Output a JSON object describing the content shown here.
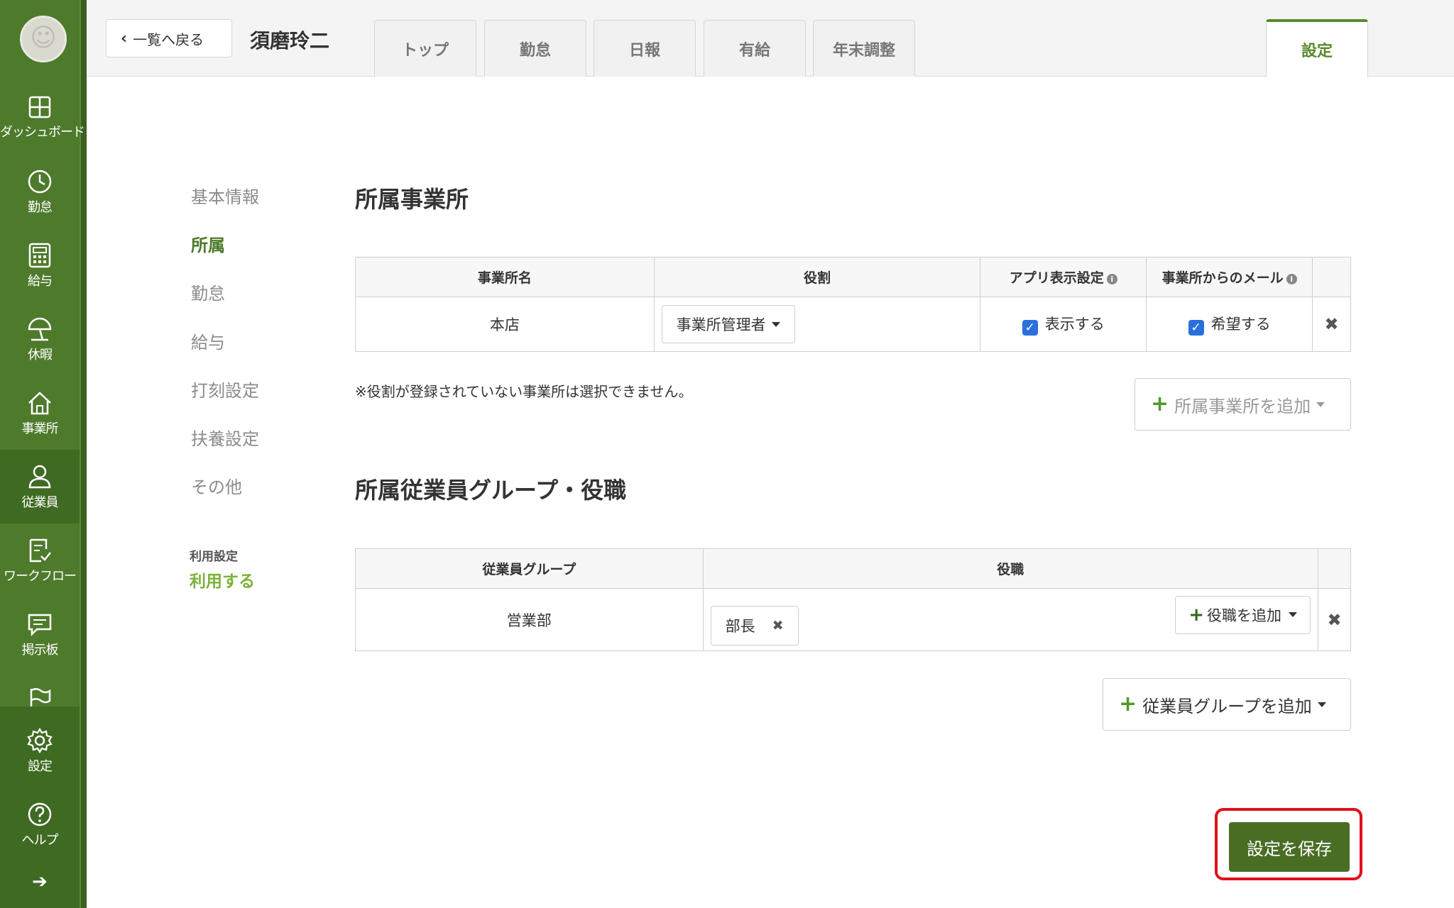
{
  "sidebar": {
    "items": [
      {
        "label": "ダッシュボード",
        "icon": "dashboard-icon"
      },
      {
        "label": "勤怠",
        "icon": "clock-icon"
      },
      {
        "label": "給与",
        "icon": "calculator-icon"
      },
      {
        "label": "休暇",
        "icon": "umbrella-icon"
      },
      {
        "label": "事業所",
        "icon": "home-icon"
      },
      {
        "label": "従業員",
        "icon": "person-icon"
      },
      {
        "label": "ワークフロー",
        "icon": "checklist-icon"
      },
      {
        "label": "掲示板",
        "icon": "message-icon"
      },
      {
        "label": "",
        "icon": "flag-icon"
      },
      {
        "label": "設定",
        "icon": "gear-icon"
      },
      {
        "label": "ヘルプ",
        "icon": "help-icon"
      }
    ],
    "active": "従業員",
    "expand_icon": "arrow-right-icon"
  },
  "header": {
    "back_label": "一覧へ戻る",
    "employee_name": "須磨玲二",
    "tabs": [
      "トップ",
      "勤怠",
      "日報",
      "有給",
      "年末調整"
    ],
    "active_tab": "設定"
  },
  "subnav": {
    "items": [
      "基本情報",
      "所属",
      "勤怠",
      "給与",
      "打刻設定",
      "扶養設定",
      "その他"
    ],
    "active": "所属",
    "usage_label": "利用設定",
    "usage_value": "利用する"
  },
  "office_section": {
    "title": "所属事業所",
    "columns": [
      "事業所名",
      "役割",
      "アプリ表示設定",
      "事業所からのメール"
    ],
    "rows": [
      {
        "name": "本店",
        "role": "事業所管理者",
        "app_display": "表示する",
        "app_display_checked": true,
        "email": "希望する",
        "email_checked": true
      }
    ],
    "note": "※役割が登録されていない事業所は選択できません。",
    "add_label": "所属事業所を追加"
  },
  "group_section": {
    "title": "所属従業員グループ・役職",
    "columns": [
      "従業員グループ",
      "役職"
    ],
    "rows": [
      {
        "group": "営業部",
        "position_tag": "部長",
        "add_position_label": "役職を追加"
      }
    ],
    "add_label": "従業員グループを追加"
  },
  "save_label": "設定を保存",
  "colors": {
    "brand": "#4e7a2c",
    "accent": "#7ab23a",
    "highlight": "#e0101a"
  }
}
